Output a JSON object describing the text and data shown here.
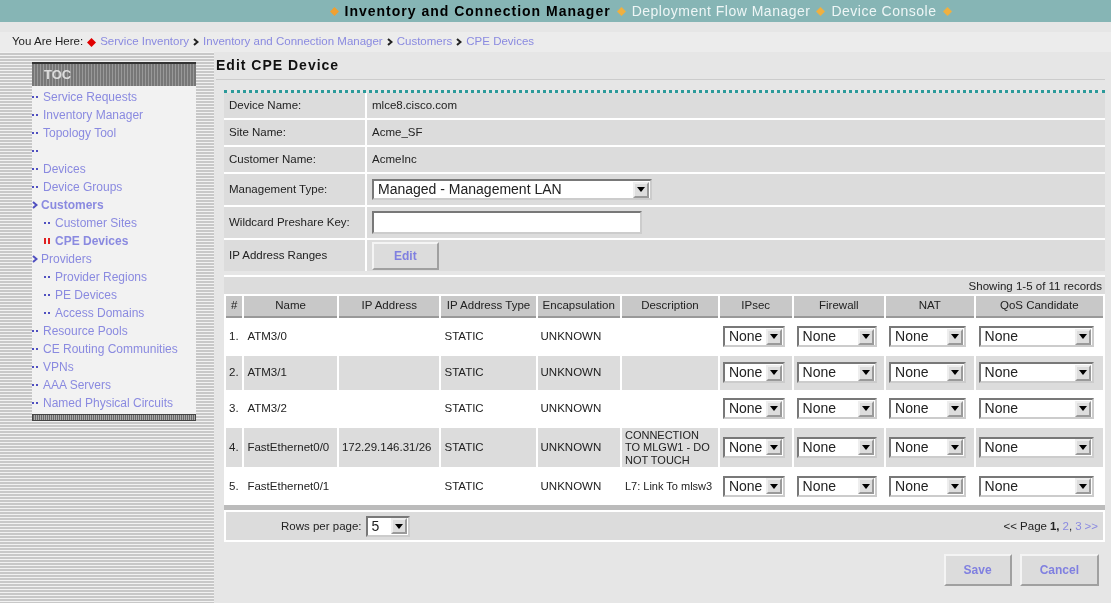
{
  "top_menu": [
    {
      "label": "Inventory and Connection Manager",
      "selected": true
    },
    {
      "label": "Deployment Flow Manager",
      "selected": false
    },
    {
      "label": "Device Console",
      "selected": false
    }
  ],
  "breadcrumb": {
    "label": "You Are Here:",
    "items": [
      "Service Inventory",
      "Inventory and Connection Manager",
      "Customers",
      "CPE Devices"
    ]
  },
  "toc": {
    "title": "TOC",
    "items": [
      {
        "kind": "leaf",
        "label": "Service Requests",
        "selected": false
      },
      {
        "kind": "leaf",
        "label": "Inventory Manager",
        "selected": false
      },
      {
        "kind": "leaf",
        "label": "Topology Tool",
        "selected": false
      },
      {
        "kind": "blank"
      },
      {
        "kind": "leaf",
        "label": "Devices",
        "selected": false
      },
      {
        "kind": "leaf",
        "label": "Device Groups",
        "selected": false
      },
      {
        "kind": "folder",
        "label": "Customers",
        "selected": false,
        "in_path": true,
        "children": [
          {
            "kind": "leaf",
            "label": "Customer Sites",
            "selected": false
          },
          {
            "kind": "leaf",
            "label": "CPE Devices",
            "selected": true
          }
        ]
      },
      {
        "kind": "folder",
        "label": "Providers",
        "selected": false,
        "in_path": false,
        "children": [
          {
            "kind": "leaf",
            "label": "Provider Regions",
            "selected": false
          },
          {
            "kind": "leaf",
            "label": "PE Devices",
            "selected": false
          },
          {
            "kind": "leaf",
            "label": "Access Domains",
            "selected": false
          }
        ]
      },
      {
        "kind": "leaf",
        "label": "Resource Pools",
        "selected": false
      },
      {
        "kind": "leaf",
        "label": "CE Routing Communities",
        "selected": false
      },
      {
        "kind": "leaf",
        "label": "VPNs",
        "selected": false
      },
      {
        "kind": "leaf",
        "label": "AAA Servers",
        "selected": false
      },
      {
        "kind": "leaf",
        "label": "Named Physical Circuits",
        "selected": false
      }
    ]
  },
  "page_title": "Edit CPE Device",
  "form": [
    {
      "kind": "text",
      "label": "Device Name:",
      "value": "mlce8.cisco.com"
    },
    {
      "kind": "text",
      "label": "Site Name:",
      "value": "Acme_SF"
    },
    {
      "kind": "text",
      "label": "Customer Name:",
      "value": "AcmeInc"
    },
    {
      "kind": "select",
      "label": "Management Type:",
      "value": "Managed - Management LAN"
    },
    {
      "kind": "input",
      "label": "Wildcard Preshare Key:"
    },
    {
      "kind": "button",
      "label": "IP Address Ranges",
      "button": "Edit"
    }
  ],
  "table": {
    "summary": "Showing 1-5 of 11 records",
    "columns": [
      "#",
      "Name",
      "IP Address",
      "IP Address Type",
      "Encapsulation",
      "Description",
      "IPsec",
      "Firewall",
      "NAT",
      "QoS Candidate"
    ],
    "rows": [
      {
        "number": "1.",
        "name": "ATM3/0",
        "type": "STATIC",
        "encapsulation": "UNKNOWN",
        "ipsec": "None",
        "firewall": "None",
        "nat": "None",
        "qos": "None"
      },
      {
        "number": "2.",
        "name": "ATM3/1",
        "type": "STATIC",
        "encapsulation": "UNKNOWN",
        "ipsec": "None",
        "firewall": "None",
        "nat": "None",
        "qos": "None"
      },
      {
        "number": "3.",
        "name": "ATM3/2",
        "type": "STATIC",
        "encapsulation": "UNKNOWN",
        "ipsec": "None",
        "firewall": "None",
        "nat": "None",
        "qos": "None"
      },
      {
        "number": "4.",
        "name": "FastEthernet0/0",
        "ip": "172.29.146.31/26",
        "type": "STATIC",
        "encapsulation": "UNKNOWN",
        "description": "CONNECTION TO MLGW1 - DO NOT TOUCH",
        "ipsec": "None",
        "firewall": "None",
        "nat": "None",
        "qos": "None"
      },
      {
        "number": "5.",
        "name": "FastEthernet0/1",
        "type": "STATIC",
        "encapsulation": "UNKNOWN",
        "description": "L7: Link To mlsw3",
        "ipsec": "None",
        "firewall": "None",
        "nat": "None",
        "qos": "None"
      }
    ]
  },
  "rows_per_page": {
    "label": "Rows per page:",
    "value": "5"
  },
  "pager": {
    "prefix": "<< Page",
    "separator": ",",
    "pages": [
      {
        "label": "1",
        "selected": true
      },
      {
        "label": "2",
        "selected": false
      },
      {
        "label": "3",
        "selected": false
      }
    ],
    "next": ">>"
  },
  "buttons": [
    "Save",
    "Cancel"
  ]
}
